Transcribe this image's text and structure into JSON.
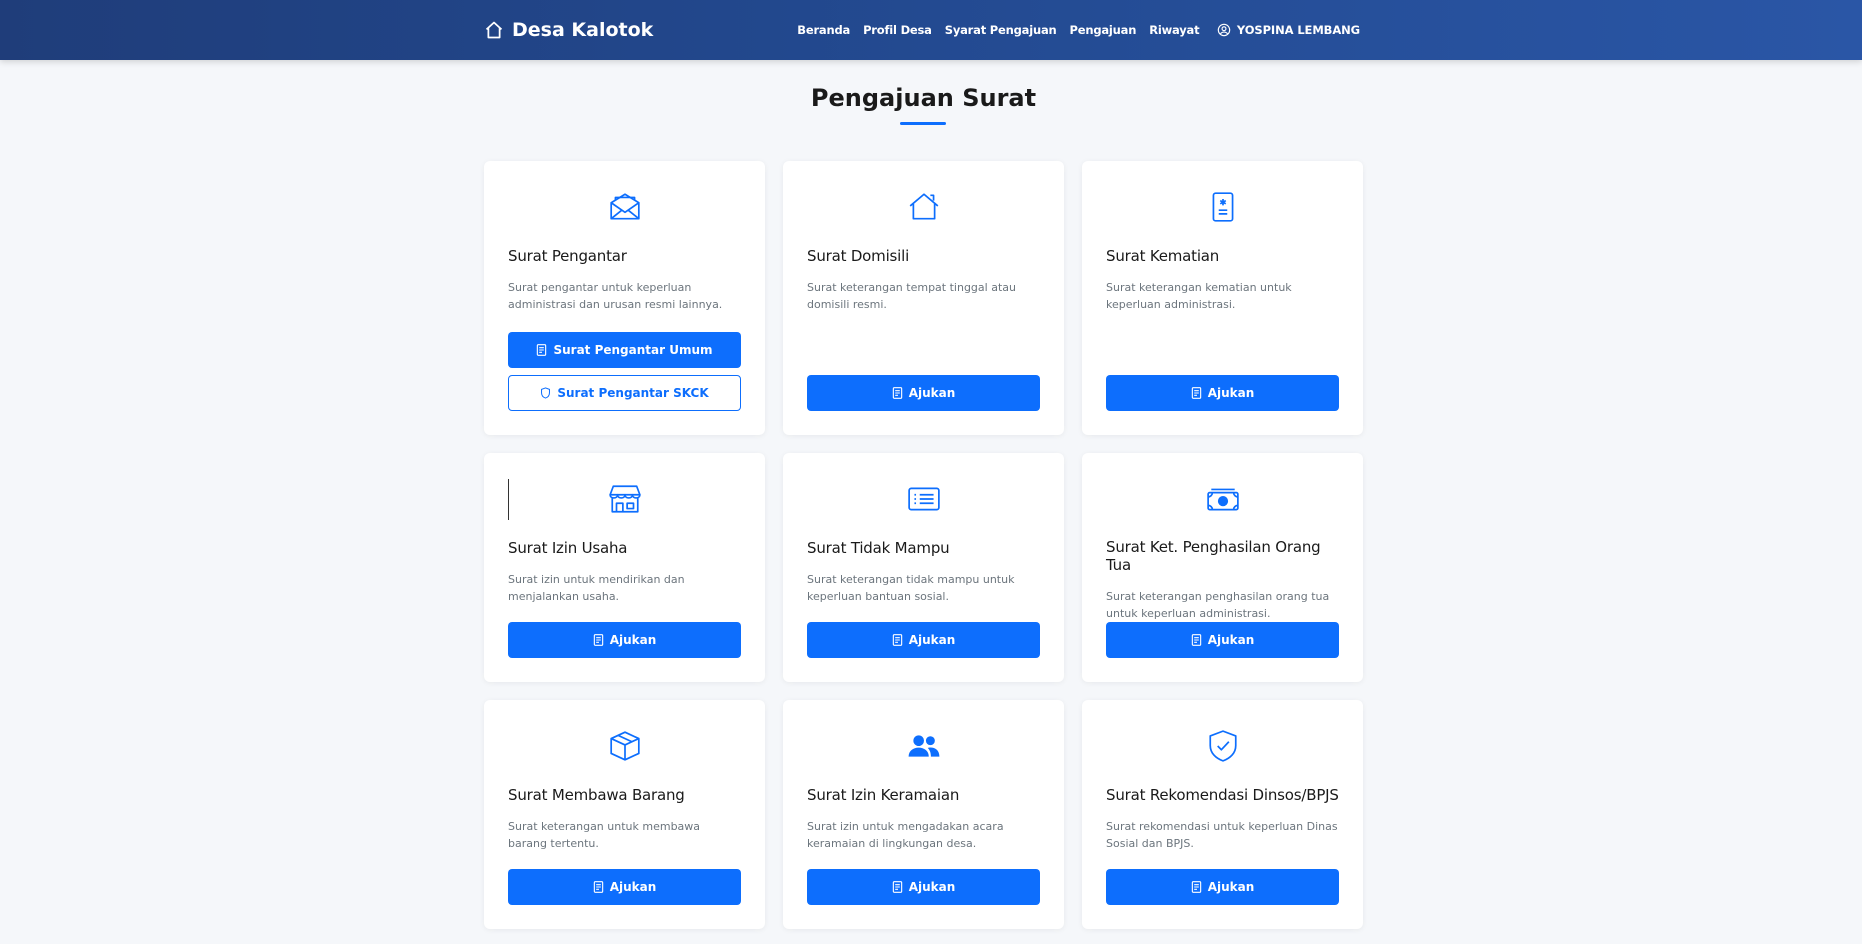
{
  "nav": {
    "brand": "Desa Kalotok",
    "links": [
      "Beranda",
      "Profil Desa",
      "Syarat Pengajuan",
      "Pengajuan",
      "Riwayat"
    ],
    "user": "YOSPINA LEMBANG"
  },
  "page": {
    "title": "Pengajuan Surat"
  },
  "colors": {
    "primary": "#0d6efd",
    "navbar": "#234a91"
  },
  "cards": [
    {
      "icon": "envelope-open-icon",
      "title": "Surat Pengantar",
      "desc": "Surat pengantar untuk keperluan administrasi dan urusan resmi lainnya.",
      "btn_primary": "Surat Pengantar Umum",
      "btn_outline": "Surat Pengantar SKCK"
    },
    {
      "icon": "house-icon",
      "title": "Surat Domisili",
      "desc": "Surat keterangan tempat tinggal atau domisili resmi.",
      "btn": "Ajukan"
    },
    {
      "icon": "document-medical-icon",
      "title": "Surat Kematian",
      "desc": "Surat keterangan kematian untuk keperluan administrasi.",
      "btn": "Ajukan"
    },
    {
      "icon": "shop-icon",
      "title": "Surat Izin Usaha",
      "desc": "Surat izin untuk mendirikan dan menjalankan usaha.",
      "btn": "Ajukan"
    },
    {
      "icon": "list-card-icon",
      "title": "Surat Tidak Mampu",
      "desc": "Surat keterangan tidak mampu untuk keperluan bantuan sosial.",
      "btn": "Ajukan"
    },
    {
      "icon": "cash-icon",
      "title": "Surat Ket. Penghasilan Orang Tua",
      "desc": "Surat keterangan penghasilan orang tua untuk keperluan administrasi.",
      "btn": "Ajukan"
    },
    {
      "icon": "box-icon",
      "title": "Surat Membawa Barang",
      "desc": "Surat keterangan untuk membawa barang tertentu.",
      "btn": "Ajukan"
    },
    {
      "icon": "people-icon",
      "title": "Surat Izin Keramaian",
      "desc": "Surat izin untuk mengadakan acara keramaian di lingkungan desa.",
      "btn": "Ajukan"
    },
    {
      "icon": "shield-check-icon",
      "title": "Surat Rekomendasi Dinsos/BPJS",
      "desc": "Surat rekomendasi untuk keperluan Dinas Sosial dan BPJS.",
      "btn": "Ajukan"
    }
  ]
}
